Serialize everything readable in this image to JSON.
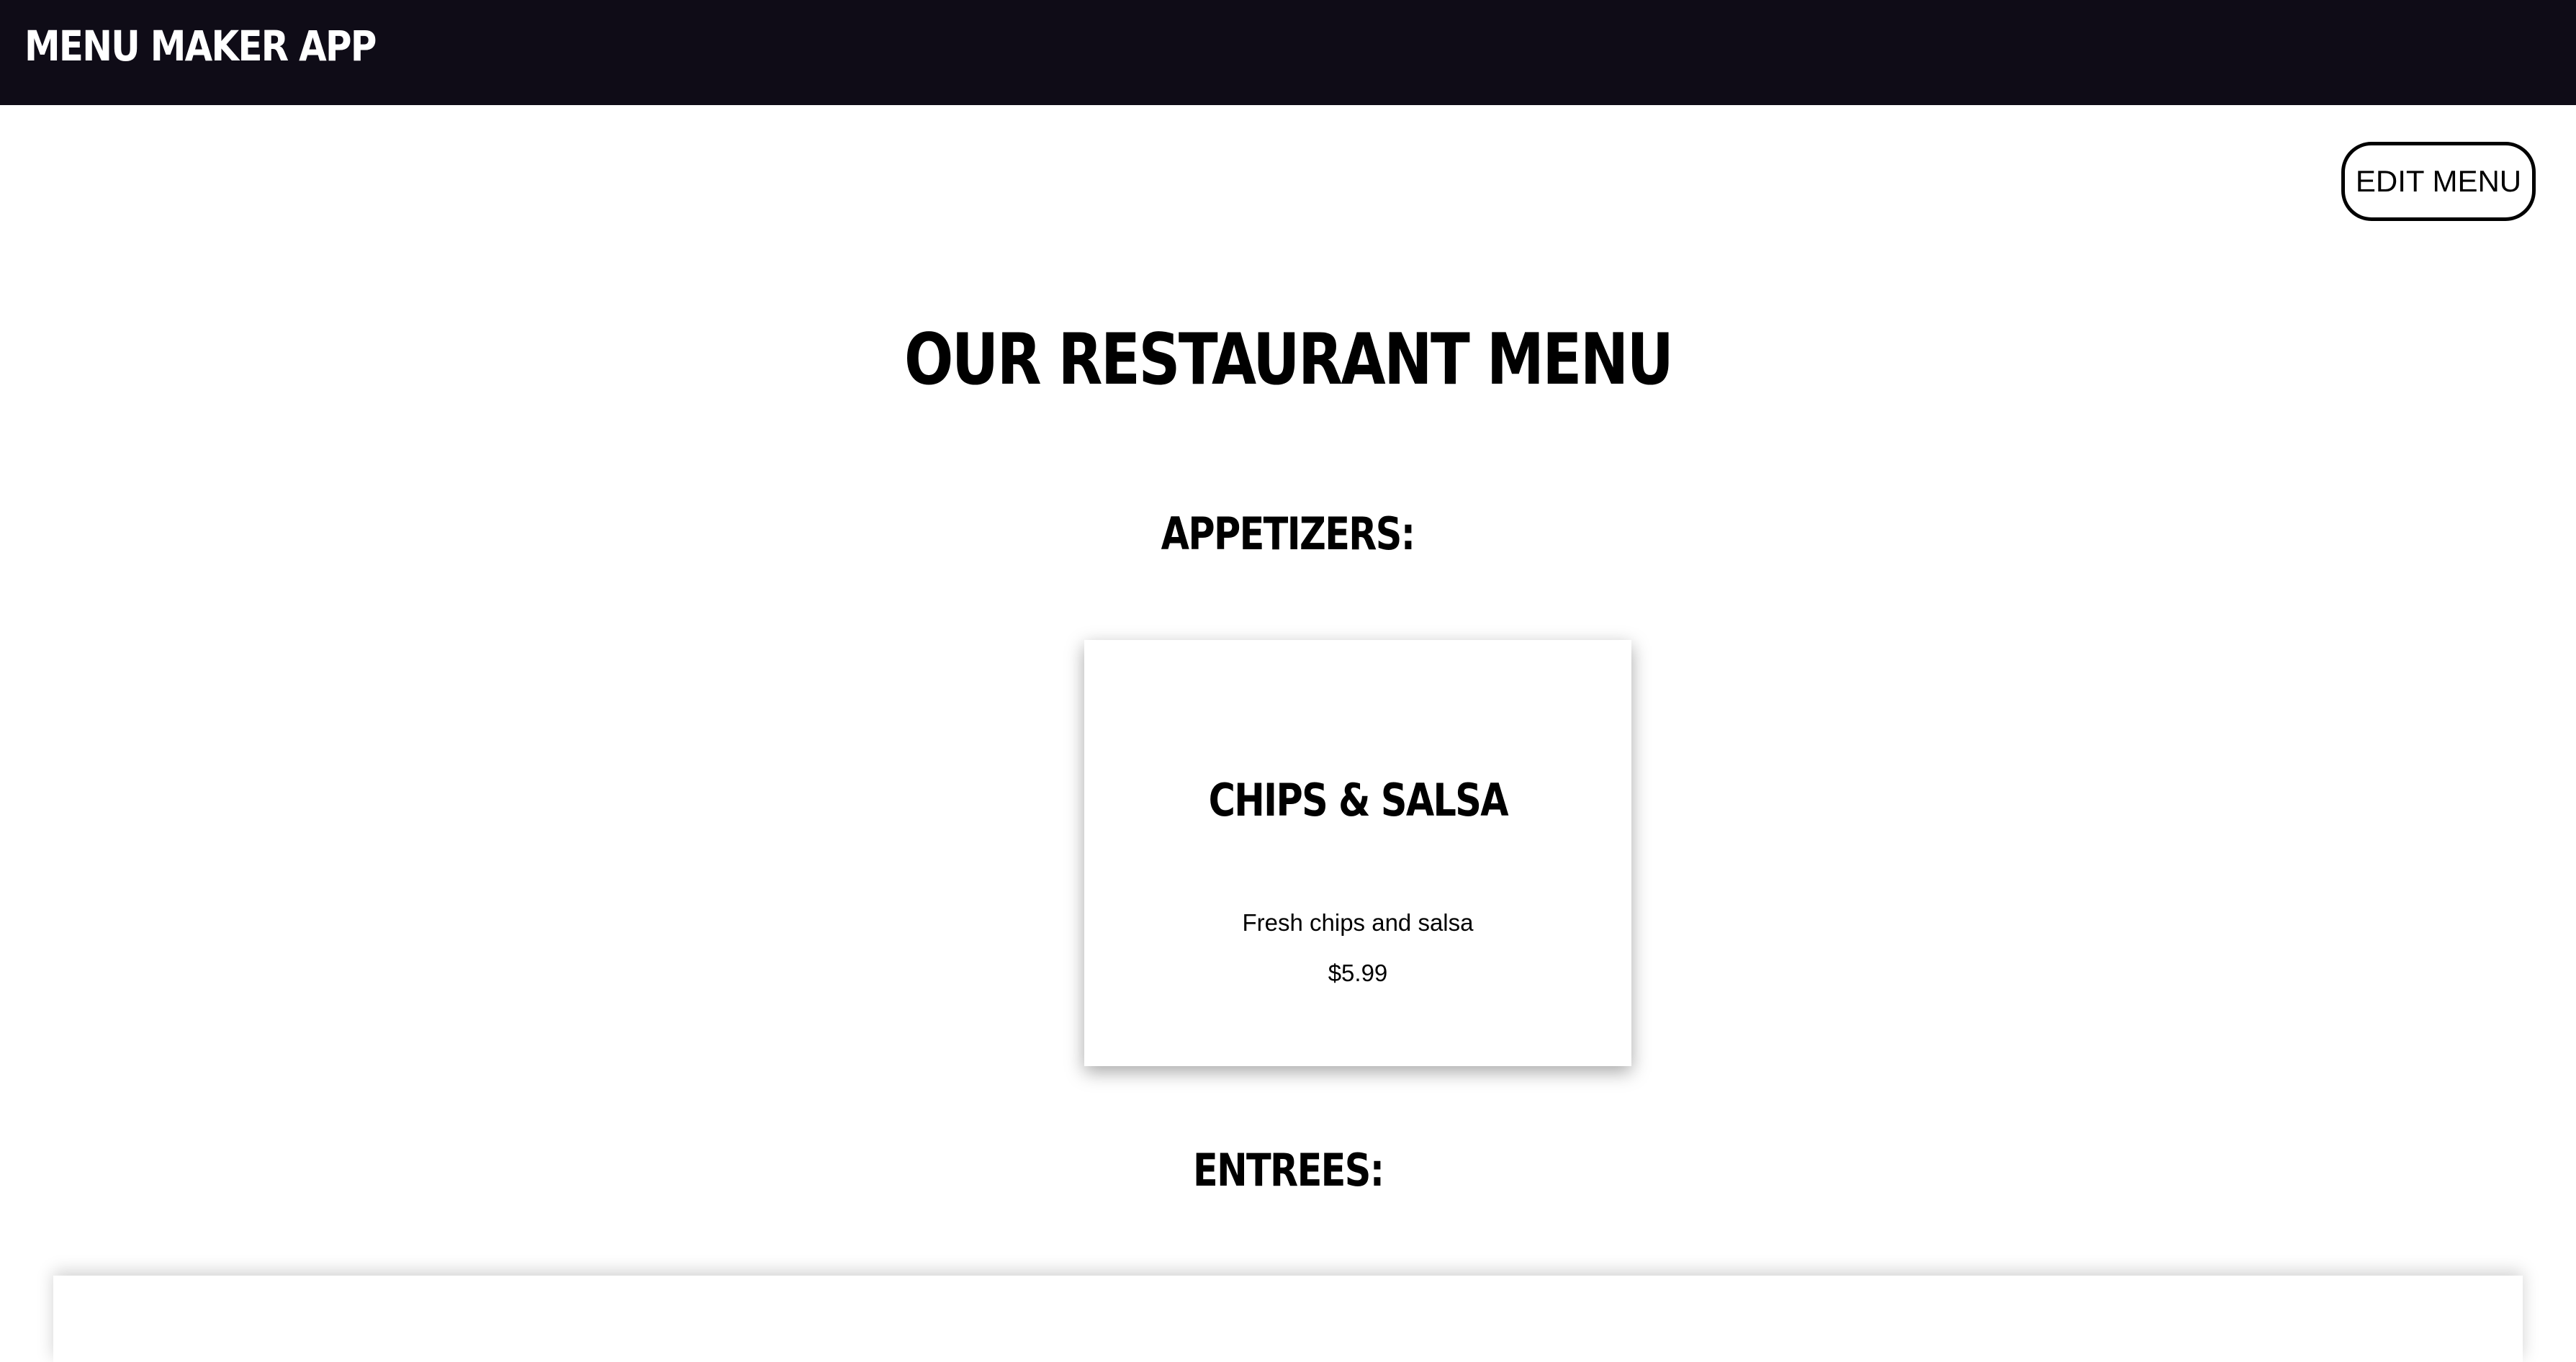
{
  "header": {
    "app_title": "MENU MAKER APP"
  },
  "toolbar": {
    "edit_menu_label": "EDIT MENU"
  },
  "main": {
    "page_title": "OUR RESTAURANT MENU",
    "sections": [
      {
        "heading": "APPETIZERS:",
        "items": [
          {
            "name": "CHIPS & SALSA",
            "description": "Fresh chips and salsa",
            "price": "$5.99"
          }
        ]
      },
      {
        "heading": "ENTREES:",
        "items": []
      }
    ]
  },
  "colors": {
    "header_bg": "#0f0c17",
    "header_text": "#ffffff",
    "page_bg": "#ffffff",
    "text": "#000000"
  }
}
